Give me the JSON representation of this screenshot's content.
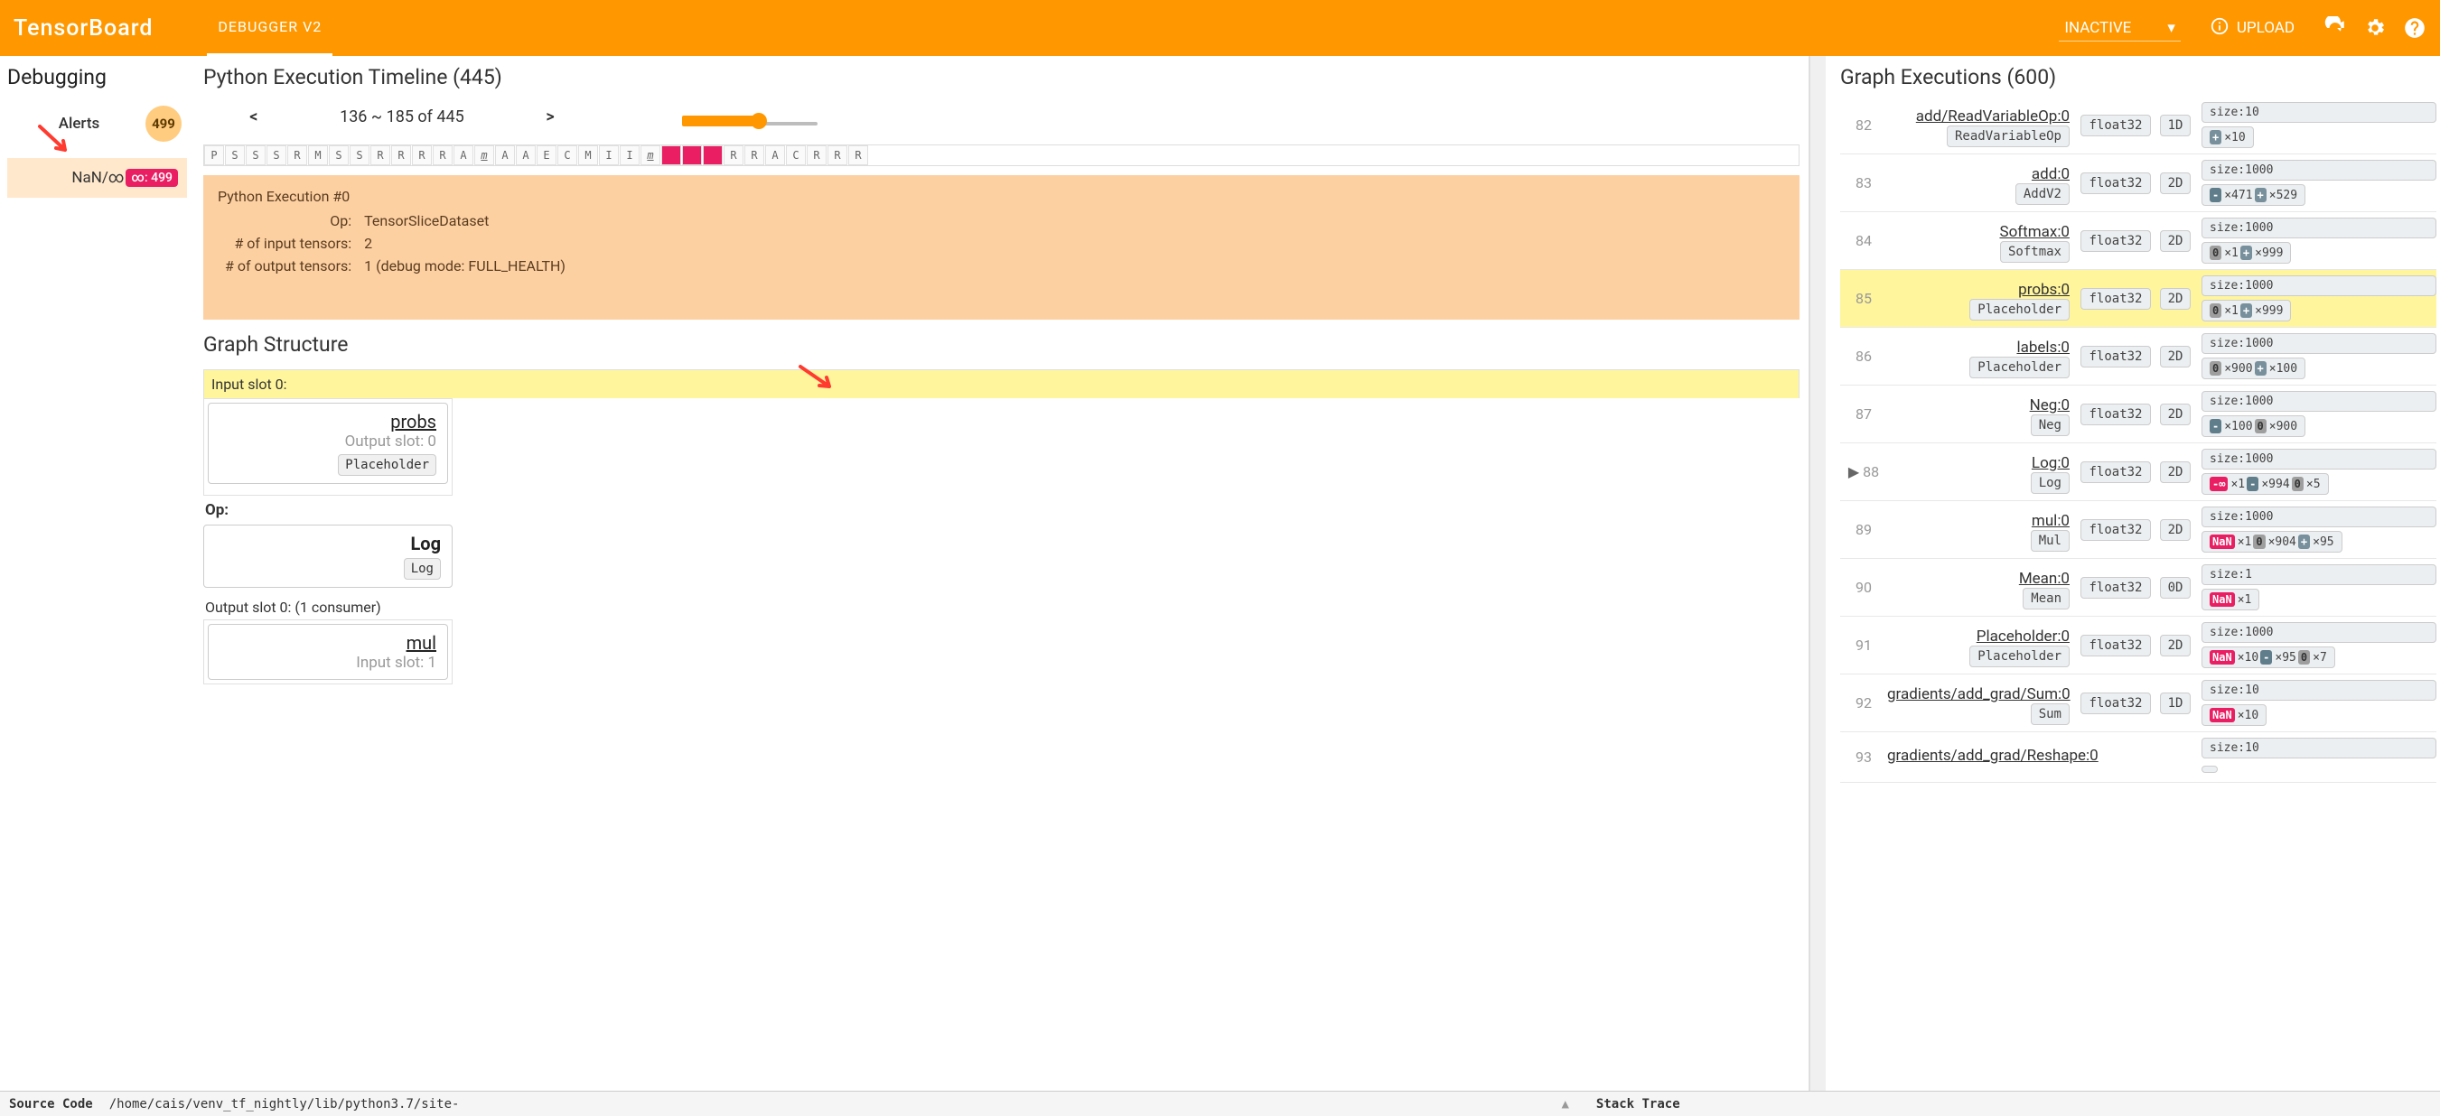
{
  "header": {
    "brand": "TensorBoard",
    "tab": "DEBUGGER V2",
    "dropdown": "INACTIVE",
    "upload": "UPLOAD"
  },
  "sidebar": {
    "title": "Debugging",
    "alertsLabel": "Alerts",
    "alertsCount": "499",
    "alertName": "NaN/∞",
    "alertPill": "∞: 499"
  },
  "timeline": {
    "title": "Python Execution Timeline (445)",
    "range": "136 ~ 185 of 445",
    "prev": "<",
    "next": ">",
    "cells": [
      "P",
      "S",
      "S",
      "S",
      "R",
      "M",
      "S",
      "S",
      "R",
      "R",
      "R",
      "R",
      "A",
      "m",
      "A",
      "A",
      "E",
      "C",
      "M",
      "I",
      "I",
      "m",
      "!",
      "-",
      "-",
      "R",
      "R",
      "A",
      "C",
      "R",
      "R",
      "R"
    ],
    "magenta": [
      22,
      23,
      24
    ],
    "underline": [
      13,
      21
    ]
  },
  "exec": {
    "hdr": "Python Execution #0",
    "rows": [
      [
        "Op:",
        "TensorSliceDataset"
      ],
      [
        "# of input tensors:",
        "2"
      ],
      [
        "# of output tensors:",
        "1   (debug mode: FULL_HEALTH)"
      ]
    ]
  },
  "gs": {
    "title": "Graph Structure",
    "in": "Input slot 0:",
    "probs": "probs",
    "probsSub": "Output slot: 0",
    "probsChip": "Placeholder",
    "opHdr": "Op:",
    "log": "Log",
    "logChip": "Log",
    "out": "Output slot 0: (1 consumer)",
    "mul": "mul",
    "mulSub": "Input slot: 1"
  },
  "ge": {
    "title": "Graph Executions (600)",
    "rows": [
      {
        "i": "82",
        "name": "add/ReadVariableOp:0",
        "op": "ReadVariableOp",
        "dt": "float32",
        "dim": "1D",
        "sz": "size:10",
        "h": [
          [
            "+",
            "×10"
          ]
        ]
      },
      {
        "i": "83",
        "name": "add:0",
        "op": "AddV2",
        "dt": "float32",
        "dim": "2D",
        "sz": "size:1000",
        "h": [
          [
            "-",
            "×471"
          ],
          [
            "+",
            "×529"
          ]
        ]
      },
      {
        "i": "84",
        "name": "Softmax:0",
        "op": "Softmax",
        "dt": "float32",
        "dim": "2D",
        "sz": "size:1000",
        "h": [
          [
            "0",
            "×1"
          ],
          [
            "+",
            "×999"
          ]
        ]
      },
      {
        "i": "85",
        "name": "probs:0",
        "op": "Placeholder",
        "dt": "float32",
        "dim": "2D",
        "sz": "size:1000",
        "h": [
          [
            "0",
            "×1"
          ],
          [
            "+",
            "×999"
          ]
        ],
        "hl": true
      },
      {
        "i": "86",
        "name": "labels:0",
        "op": "Placeholder",
        "dt": "float32",
        "dim": "2D",
        "sz": "size:1000",
        "h": [
          [
            "0",
            "×900"
          ],
          [
            "+",
            "×100"
          ]
        ]
      },
      {
        "i": "87",
        "name": "Neg:0",
        "op": "Neg",
        "dt": "float32",
        "dim": "2D",
        "sz": "size:1000",
        "h": [
          [
            "-",
            "×100"
          ],
          [
            "0",
            "×900"
          ]
        ]
      },
      {
        "i": "88",
        "name": "Log:0",
        "op": "Log",
        "dt": "float32",
        "dim": "2D",
        "sz": "size:1000",
        "h": [
          [
            "-∞",
            "×1"
          ],
          [
            "-",
            "×994"
          ],
          [
            "0",
            "×5"
          ]
        ],
        "ptr": true
      },
      {
        "i": "89",
        "name": "mul:0",
        "op": "Mul",
        "dt": "float32",
        "dim": "2D",
        "sz": "size:1000",
        "h": [
          [
            "NaN",
            "×1"
          ],
          [
            "0",
            "×904"
          ],
          [
            "+",
            "×95"
          ]
        ]
      },
      {
        "i": "90",
        "name": "Mean:0",
        "op": "Mean",
        "dt": "float32",
        "dim": "0D",
        "sz": "size:1",
        "h": [
          [
            "NaN",
            "×1"
          ]
        ]
      },
      {
        "i": "91",
        "name": "Placeholder:0",
        "op": "Placeholder",
        "dt": "float32",
        "dim": "2D",
        "sz": "size:1000",
        "h": [
          [
            "NaN",
            "×10"
          ],
          [
            "-",
            "×95"
          ],
          [
            "0",
            "×7"
          ]
        ]
      },
      {
        "i": "92",
        "name": "gradients/add_grad/Sum:0",
        "op": "Sum",
        "dt": "float32",
        "dim": "1D",
        "sz": "size:10",
        "h": [
          [
            "NaN",
            "×10"
          ]
        ]
      },
      {
        "i": "93",
        "name": "gradients/add_grad/Reshape:0",
        "op": "",
        "dt": "",
        "dim": "",
        "sz": "size:10",
        "h": []
      }
    ]
  },
  "footer": {
    "src": "Source Code",
    "path": "/home/cais/venv_tf_nightly/lib/python3.7/site-",
    "stack": "Stack Trace"
  }
}
